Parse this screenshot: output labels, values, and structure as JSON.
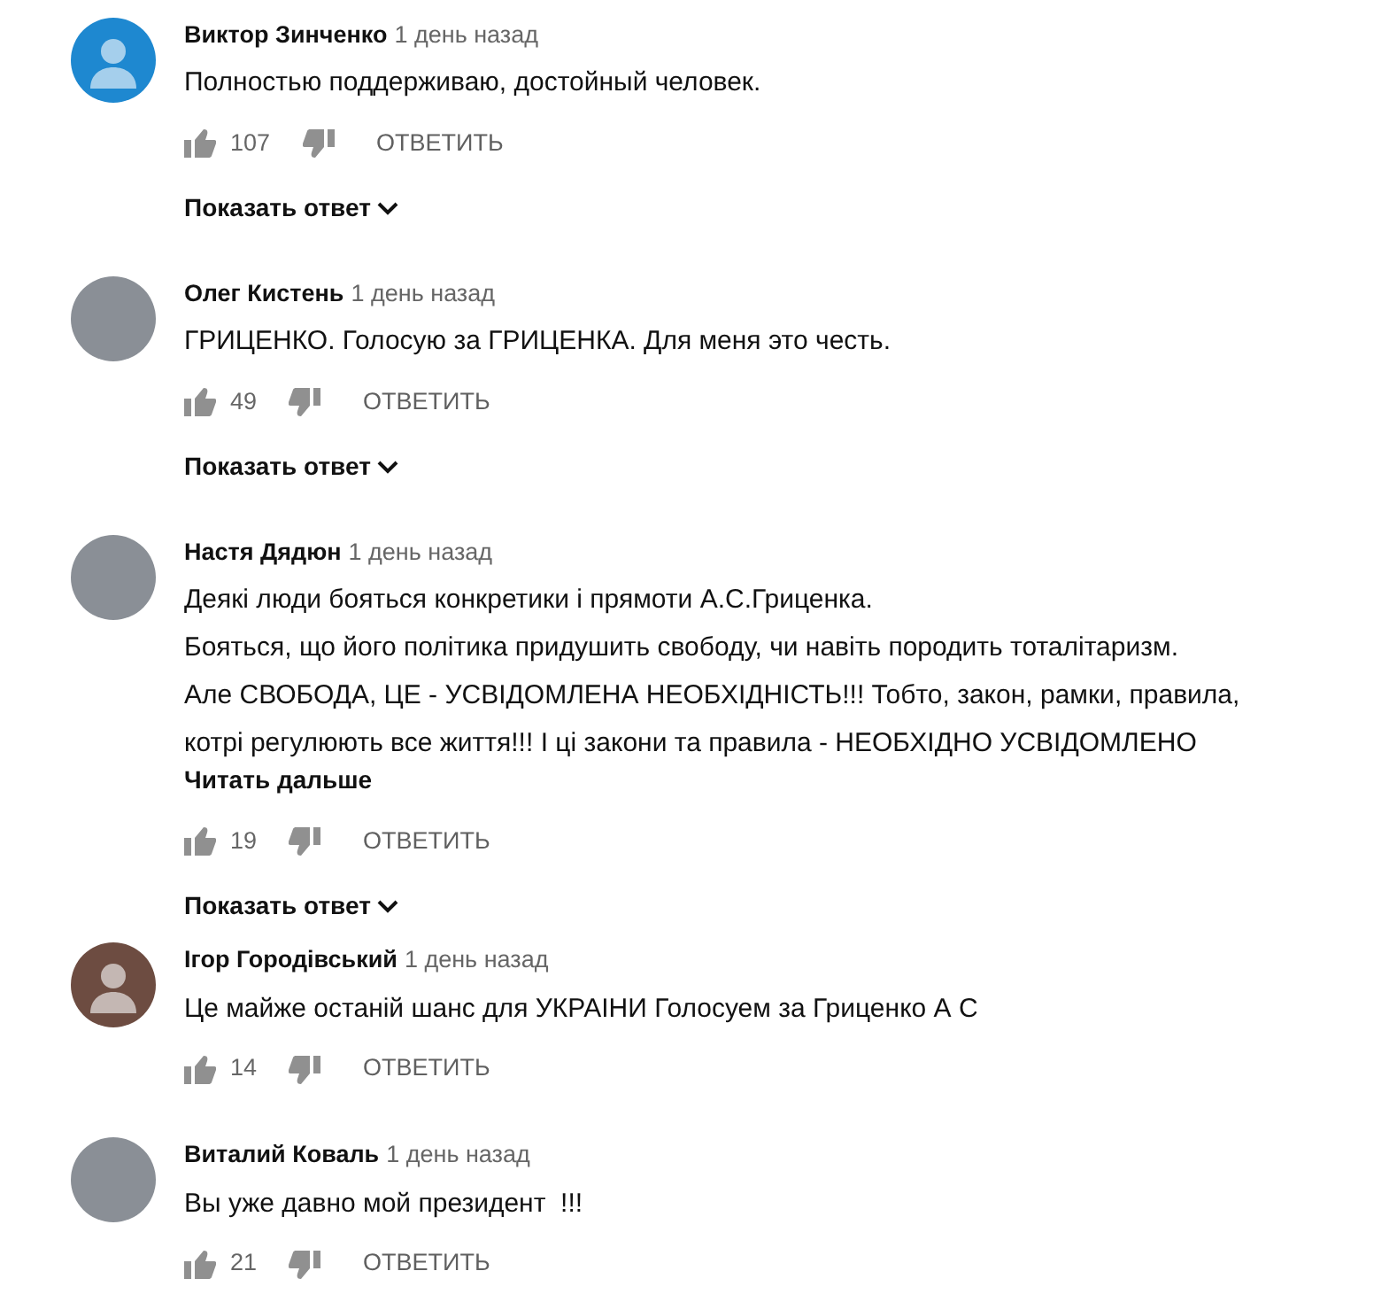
{
  "comments": [
    {
      "author": "Виктор Зинченко",
      "time": "1 день назад",
      "avatar": {
        "kind": "default",
        "color": "#1e88d0"
      },
      "text_lines": [
        "Полностью поддерживаю, достойный человек."
      ],
      "likes": "107",
      "reply": "ОТВЕТИТЬ",
      "show_replies": "Показать ответ"
    },
    {
      "author": "Олег Кистень",
      "time": "1 день назад",
      "avatar": {
        "kind": "photo"
      },
      "text_lines": [
        "ГРИЦЕНКО. Голосую за ГРИЦЕНКА. Для меня это честь."
      ],
      "likes": "49",
      "reply": "ОТВЕТИТЬ",
      "show_replies": "Показать ответ"
    },
    {
      "author": "Настя Дядюн",
      "time": "1 день назад",
      "avatar": {
        "kind": "photo"
      },
      "text_lines": [
        "Деякі люди бояться конкретики і прямоти А.С.Гриценка.",
        "Бояться, що його політика придушить свободу, чи навіть породить тоталітаризм.",
        "Але СВОБОДА, ЦЕ - УСВІДОМЛЕНА НЕОБХІДНІСТЬ!!! Тобто, закон, рамки, правила,",
        "котрі регулюють все життя!!! І ці закони та правила - НЕОБХІДНО УСВІДОМЛЕНО"
      ],
      "read_more": "Читать дальше",
      "likes": "19",
      "reply": "ОТВЕТИТЬ",
      "show_replies": "Показать ответ"
    },
    {
      "author": "Ігор Городівський",
      "time": "1 день назад",
      "avatar": {
        "kind": "default",
        "color": "#6d4c41"
      },
      "text_lines": [
        "Це майже останій шанс для УКРАІНИ Голосуем за Гриценко А С"
      ],
      "likes": "14",
      "reply": "ОТВЕТИТЬ"
    },
    {
      "author": "Виталий Коваль",
      "time": "1 день назад",
      "avatar": {
        "kind": "photo"
      },
      "text_lines": [
        "Вы уже давно мой президент  !!!"
      ],
      "likes": "21",
      "reply": "ОТВЕТИТЬ"
    }
  ]
}
